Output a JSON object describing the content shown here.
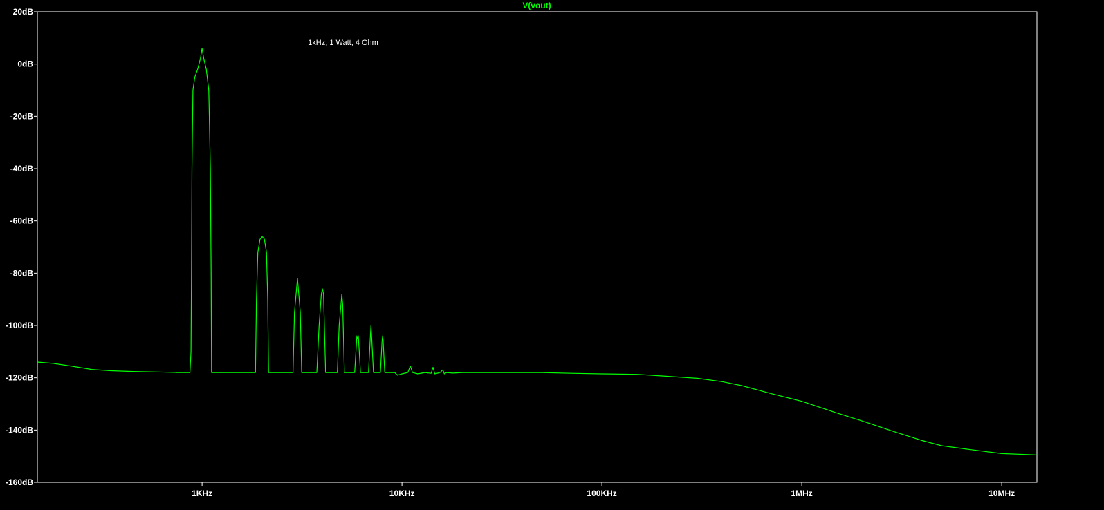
{
  "colors": {
    "background": "#000000",
    "axis": "#ffffff",
    "trace": "#00ff00",
    "text": "#ffffff"
  },
  "chart_data": {
    "type": "line",
    "title": "V(vout)",
    "annotation": "1kHz, 1 Watt, 4 Ohm",
    "xlabel": "",
    "ylabel": "",
    "xscale": "log",
    "xlim": [
      150,
      15000000
    ],
    "ylim": [
      -160,
      20
    ],
    "grid": false,
    "x_ticks": [
      {
        "value": 1000,
        "label": "1KHz"
      },
      {
        "value": 10000,
        "label": "10KHz"
      },
      {
        "value": 100000,
        "label": "100KHz"
      },
      {
        "value": 1000000,
        "label": "1MHz"
      },
      {
        "value": 10000000,
        "label": "10MHz"
      }
    ],
    "y_ticks": [
      {
        "value": 20,
        "label": "20dB"
      },
      {
        "value": 0,
        "label": "0dB"
      },
      {
        "value": -20,
        "label": "-20dB"
      },
      {
        "value": -40,
        "label": "-40dB"
      },
      {
        "value": -60,
        "label": "-60dB"
      },
      {
        "value": -80,
        "label": "-80dB"
      },
      {
        "value": -100,
        "label": "-100dB"
      },
      {
        "value": -120,
        "label": "-120dB"
      },
      {
        "value": -140,
        "label": "-140dB"
      },
      {
        "value": -160,
        "label": "-160dB"
      }
    ],
    "series": [
      {
        "name": "V(vout)",
        "x": [
          150,
          180,
          220,
          280,
          350,
          450,
          600,
          750,
          870,
          880,
          885,
          890,
          900,
          920,
          950,
          980,
          1000,
          1020,
          1050,
          1080,
          1100,
          1110,
          1115,
          1130,
          1500,
          1850,
          1870,
          1900,
          1950,
          2000,
          2050,
          2100,
          2130,
          2150,
          2700,
          2850,
          2900,
          3000,
          3100,
          3150,
          3300,
          3750,
          3850,
          3950,
          4000,
          4050,
          4150,
          4300,
          4750,
          4850,
          4950,
          5000,
          5050,
          5150,
          5300,
          5800,
          5950,
          6000,
          6050,
          6200,
          6800,
          6950,
          7000,
          7050,
          7200,
          7800,
          7950,
          8000,
          8050,
          8200,
          9000,
          9200,
          9500,
          10000,
          10700,
          11000,
          11300,
          12000,
          13000,
          14000,
          14300,
          14600,
          15500,
          16000,
          16300,
          16600,
          18000,
          20000,
          25000,
          30000,
          40000,
          50000,
          70000,
          100000,
          150000,
          200000,
          300000,
          400000,
          500000,
          700000,
          1000000,
          1500000,
          2000000,
          3000000,
          4000000,
          5000000,
          7000000,
          10000000,
          15000000
        ],
        "values": [
          -114,
          -114.5,
          -115.5,
          -116.8,
          -117.3,
          -117.6,
          -117.8,
          -118,
          -118,
          -110,
          -80,
          -40,
          -10,
          -5,
          -2,
          2,
          6,
          2,
          -2,
          -10,
          -40,
          -80,
          -118,
          -118,
          -118,
          -118,
          -90,
          -72,
          -67,
          -66,
          -67,
          -72,
          -90,
          -118,
          -118,
          -118,
          -95,
          -82,
          -95,
          -118,
          -118,
          -118,
          -100,
          -88,
          -86,
          -88,
          -118,
          -118,
          -118,
          -100,
          -92,
          -88,
          -92,
          -118,
          -118,
          -118,
          -104,
          -105,
          -104,
          -118,
          -118,
          -104,
          -100,
          -104,
          -118,
          -118,
          -106,
          -104,
          -106,
          -118,
          -118,
          -118,
          -119,
          -118.5,
          -118,
          -115.5,
          -118,
          -118.5,
          -118,
          -118.3,
          -116,
          -118.5,
          -118,
          -117,
          -118.5,
          -118,
          -118.2,
          -118,
          -118,
          -118,
          -118,
          -118,
          -118.3,
          -118.5,
          -118.7,
          -119.3,
          -120.2,
          -121.5,
          -123,
          -126,
          -129,
          -133.5,
          -136.5,
          -141,
          -144,
          -146,
          -147.5,
          -149,
          -149.5
        ]
      }
    ]
  }
}
